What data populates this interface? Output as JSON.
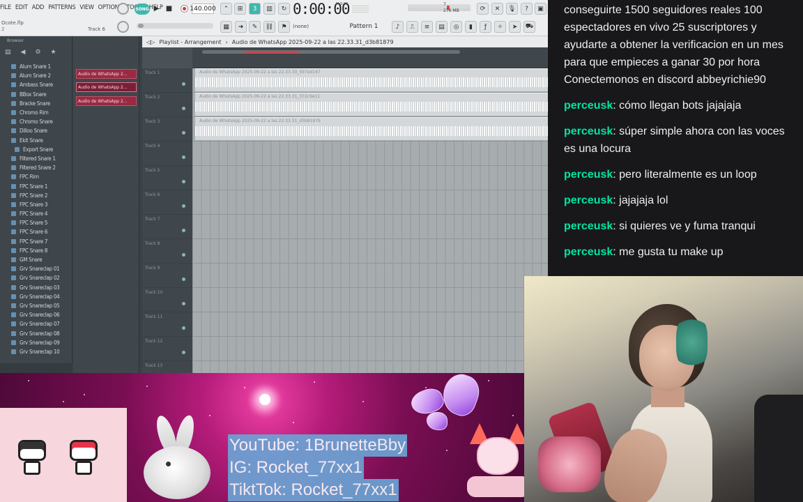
{
  "fl": {
    "menu": [
      "FILE",
      "EDIT",
      "ADD",
      "PATTERNS",
      "VIEW",
      "OPTIONS",
      "TOOLS",
      "HELP"
    ],
    "project_file": "Ocote.flp",
    "project_sub": "2",
    "track_hint": "Track 6",
    "song_mode": "SONG",
    "tempo": "140.000",
    "time": "0:00:00",
    "time_unit": "M:S:CS",
    "cpu_lines": [
      "7",
      "276 MB",
      "0"
    ],
    "snap": "(none)",
    "pattern": "Pattern 1",
    "browser_title": "Browser",
    "browser_items": [
      {
        "label": "Alum Snare 1",
        "sub": false
      },
      {
        "label": "Alum Snare 2",
        "sub": false
      },
      {
        "label": "Ambass Snare",
        "sub": false
      },
      {
        "label": "BBox Snare",
        "sub": false
      },
      {
        "label": "Bracke Snare",
        "sub": false
      },
      {
        "label": "Chromo Rim",
        "sub": false
      },
      {
        "label": "Chromo Snare",
        "sub": false
      },
      {
        "label": "Dilloo Snare",
        "sub": false
      },
      {
        "label": "Ekit Snare",
        "sub": false
      },
      {
        "label": "Export Snare",
        "sub": true
      },
      {
        "label": "Filtered Snare 1",
        "sub": false
      },
      {
        "label": "Filtered Snare 2",
        "sub": false
      },
      {
        "label": "FPC Rim",
        "sub": false
      },
      {
        "label": "FPC Snare 1",
        "sub": false
      },
      {
        "label": "FPC Snare 2",
        "sub": false
      },
      {
        "label": "FPC Snare 3",
        "sub": false
      },
      {
        "label": "FPC Snare 4",
        "sub": false
      },
      {
        "label": "FPC Snare 5",
        "sub": false
      },
      {
        "label": "FPC Snare 6",
        "sub": false
      },
      {
        "label": "FPC Snare 7",
        "sub": false
      },
      {
        "label": "FPC Snare 8",
        "sub": false
      },
      {
        "label": "GM Snare",
        "sub": false
      },
      {
        "label": "Grv Snareclap 01",
        "sub": false
      },
      {
        "label": "Grv Snareclap 02",
        "sub": false
      },
      {
        "label": "Grv Snareclap 03",
        "sub": false
      },
      {
        "label": "Grv Snareclap 04",
        "sub": false
      },
      {
        "label": "Grv Snareclap 05",
        "sub": false
      },
      {
        "label": "Grv Snareclap 06",
        "sub": false
      },
      {
        "label": "Grv Snareclap 07",
        "sub": false
      },
      {
        "label": "Grv Snareclap 08",
        "sub": false
      },
      {
        "label": "Grv Snareclap 09",
        "sub": false
      },
      {
        "label": "Grv Snareclap 10",
        "sub": false
      }
    ],
    "channel_clips": [
      "Audio de WhatsApp 2...",
      "Audio de WhatsApp 2...",
      "Audio de WhatsApp 2..."
    ],
    "playlist_title": "Playlist - Arrangement",
    "playlist_breadcrumb": "Audio de WhatsApp 2025-09-22 a las 22.33.31_d3b81879",
    "tracks": [
      "Track 1",
      "Track 2",
      "Track 3",
      "Track 4",
      "Track 5",
      "Track 6",
      "Track 7",
      "Track 8",
      "Track 9",
      "Track 10",
      "Track 11",
      "Track 12",
      "Track 13"
    ],
    "audio_clips": [
      "Audio de WhatsApp 2025-09-22 a las 22.33.30_597ed167",
      "Audio de WhatsApp 2025-09-22 a las 22.33.31_372c9e11",
      "Audio de WhatsApp 2025-09-22 a las 22.33.31_d3b81879"
    ]
  },
  "chat": {
    "top_message": "conseguirte 1500 seguidores reales 100 espectadores en vivo 25 suscriptores y ayudarte a obtener la verificacion en un mes para que empieces a ganar 30 por hora Conectemonos en discord abbeyrichie90",
    "messages": [
      {
        "user": "perceusk",
        "text": "cómo llegan bots jajajaja"
      },
      {
        "user": "perceusk",
        "text": "súper simple ahora con las voces es una locura"
      },
      {
        "user": "perceusk",
        "text": "pero literalmente es un loop"
      },
      {
        "user": "perceusk",
        "text": "jajajaja lol"
      },
      {
        "user": "perceusk",
        "text": "si quieres ve y fuma tranqui"
      },
      {
        "user": "perceusk",
        "text": "me gusta tu make up"
      }
    ]
  },
  "overlay": {
    "socials": [
      "YouTube: 1BrunetteBby",
      "IG: Rocket_77xx1",
      "TiktTok: Rocket_77xx1"
    ]
  },
  "colors": {
    "chat_username": "#00e5a1",
    "chat_bg": "#18181b",
    "clip_red": "#9a2a44",
    "overlay_magenta": "#b51c7a",
    "social_box": "#6aa6d6"
  }
}
